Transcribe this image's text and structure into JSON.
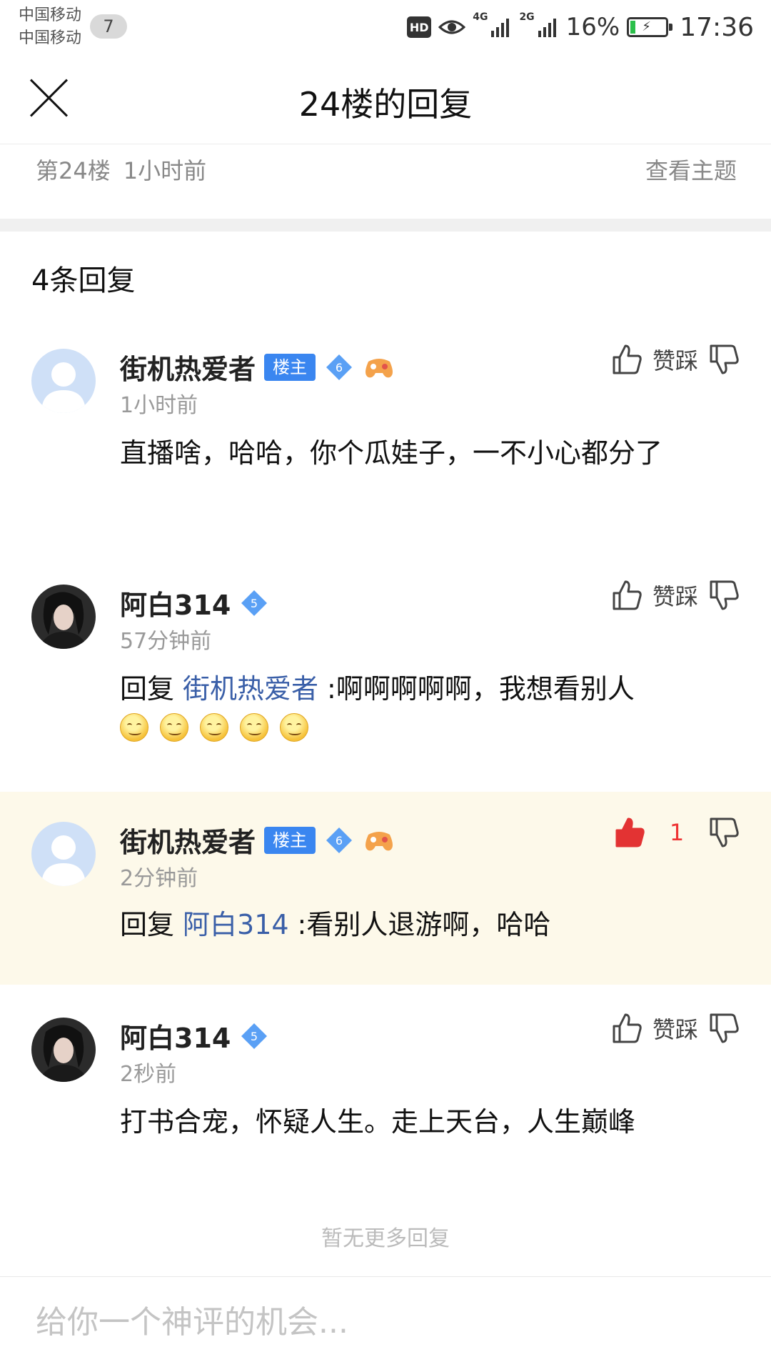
{
  "status_bar": {
    "carrier1": "中国移动",
    "carrier2": "中国移动",
    "notification_count": "7",
    "hd": "HD",
    "net1": "4G",
    "net2": "2G",
    "battery": "16%",
    "battery_level_pct": 16,
    "time": "17:36"
  },
  "header": {
    "title": "24楼的回复"
  },
  "floor": {
    "label": "第24楼",
    "time": "1小时前",
    "view_topic": "查看主题"
  },
  "reply_count": "4条回复",
  "vote_label": "赞踩",
  "replies": [
    {
      "user": "街机热爱者",
      "badge": "楼主",
      "level": "6",
      "time": "1小时前",
      "text": "直播啥，哈哈，你个瓜娃子，一不小心都分了"
    },
    {
      "user": "阿白314",
      "level": "5",
      "time": "57分钟前",
      "prefix": "回复",
      "mention": "街机热爱者",
      "text": ":啊啊啊啊啊，我想看别人"
    },
    {
      "user": "街机热爱者",
      "badge": "楼主",
      "level": "6",
      "time": "2分钟前",
      "prefix": "回复",
      "mention": "阿白314",
      "text": ":看别人退游啊，哈哈",
      "likes": "1"
    },
    {
      "user": "阿白314",
      "level": "5",
      "time": "2秒前",
      "text": "打书合宠，怀疑人生。走上天台，人生巅峰"
    }
  ],
  "no_more": "暂无更多回复",
  "comment_box": {
    "placeholder": "给你一个神评的机会..."
  },
  "colors": {
    "accent": "#3a86f0",
    "like_active": "#e33333",
    "highlight_bg": "#fdf9ea"
  },
  "icons": [
    "close-icon",
    "thumb-up-icon",
    "thumb-down-icon",
    "level-diamond-icon",
    "gamepad-icon",
    "eye-icon",
    "signal-icon"
  ]
}
